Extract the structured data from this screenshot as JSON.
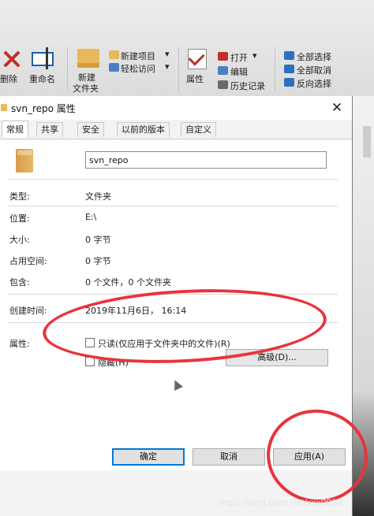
{
  "ribbon": {
    "delete_label": "删除",
    "rename_label": "重命名",
    "new_folder_line1": "新建",
    "new_folder_line2": "文件夹",
    "new_item_label": "新建项目",
    "easy_access_label": "轻松访问",
    "properties_label": "属性",
    "open_label": "打开",
    "edit_label": "编辑",
    "history_label": "历史记录",
    "select_all_label": "全部选择",
    "select_none_label": "全部取消",
    "invert_selection_label": "反向选择"
  },
  "dialog": {
    "title": "svn_repo 属性",
    "close_glyph": "✕",
    "tabs": [
      {
        "label": "常规",
        "active": true
      },
      {
        "label": "共享"
      },
      {
        "label": "安全"
      },
      {
        "label": "以前的版本"
      },
      {
        "label": "自定义"
      }
    ],
    "name_value": "svn_repo",
    "fields": {
      "type_label": "类型:",
      "type_value": "文件夹",
      "location_label": "位置:",
      "location_value": "E:\\",
      "size_label": "大小:",
      "size_value": "0 字节",
      "size_on_disk_label": "占用空间:",
      "size_on_disk_value": "0 字节",
      "contains_label": "包含:",
      "contains_value": "0 个文件，0 个文件夹",
      "created_label": "创建时间:",
      "created_value": "2019年11月6日，  16:14"
    },
    "attributes": {
      "label": "属性:",
      "readonly_label": "只读(仅应用于文件夹中的文件)(R)",
      "readonly_checked": false,
      "hidden_label": "隐藏(H)",
      "hidden_checked": false,
      "advanced_label": "高级(D)..."
    },
    "buttons": {
      "ok_label": "确定",
      "cancel_label": "取消",
      "apply_label": "应用(A)"
    }
  },
  "watermark": "https://blog.csdn.net/xxx0028",
  "colors": {
    "annotation": "#e8343c",
    "accent": "#0078d7",
    "folder": "#e8b85a"
  }
}
